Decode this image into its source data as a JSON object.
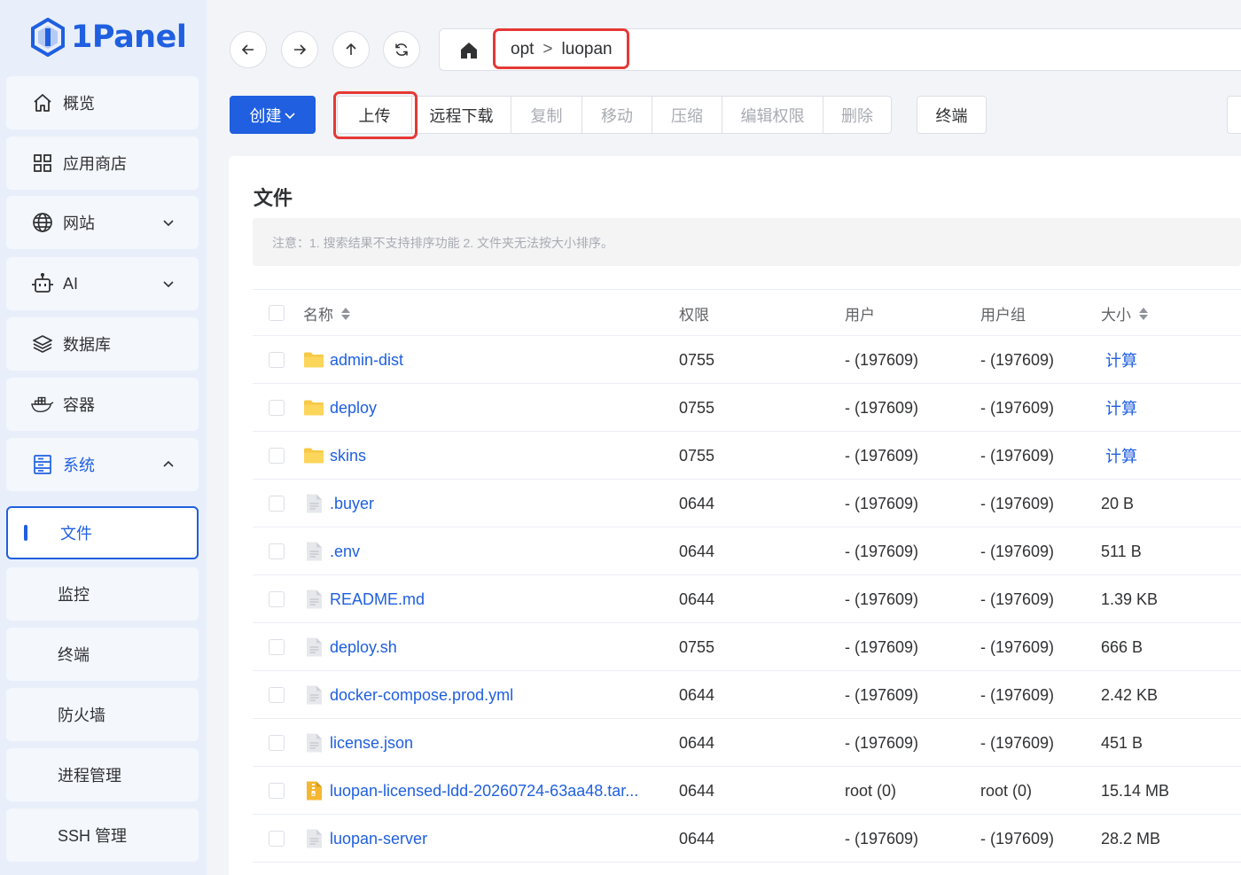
{
  "app": {
    "logo_text": "1Panel"
  },
  "sidebar": {
    "items": [
      {
        "label": "概览"
      },
      {
        "label": "应用商店"
      },
      {
        "label": "网站"
      },
      {
        "label": "AI"
      },
      {
        "label": "数据库"
      },
      {
        "label": "容器"
      },
      {
        "label": "系统"
      }
    ],
    "sub_items": [
      {
        "label": "文件"
      },
      {
        "label": "监控"
      },
      {
        "label": "终端"
      },
      {
        "label": "防火墙"
      },
      {
        "label": "进程管理"
      },
      {
        "label": "SSH 管理"
      }
    ]
  },
  "path": {
    "segments": [
      "opt",
      "luopan"
    ],
    "separator": ">"
  },
  "toolbar": {
    "create": "创建",
    "upload": "上传",
    "remote_download": "远程下载",
    "copy": "复制",
    "move": "移动",
    "compress": "压缩",
    "edit_permission": "编辑权限",
    "delete": "删除",
    "terminal": "终端"
  },
  "card": {
    "title": "文件",
    "notice": "注意：1. 搜索结果不支持排序功能 2. 文件夹无法按大小排序。"
  },
  "table": {
    "columns": {
      "name": "名称",
      "permission": "权限",
      "user": "用户",
      "group": "用户组",
      "size": "大小"
    },
    "rows": [
      {
        "name": "admin-dist",
        "type": "folder",
        "perm": "0755",
        "user": "- (197609)",
        "group": "- (197609)",
        "size": "计算"
      },
      {
        "name": "deploy",
        "type": "folder",
        "perm": "0755",
        "user": "- (197609)",
        "group": "- (197609)",
        "size": "计算"
      },
      {
        "name": "skins",
        "type": "folder",
        "perm": "0755",
        "user": "- (197609)",
        "group": "- (197609)",
        "size": "计算"
      },
      {
        "name": ".buyer",
        "type": "file",
        "perm": "0644",
        "user": "- (197609)",
        "group": "- (197609)",
        "size": "20 B"
      },
      {
        "name": ".env",
        "type": "file",
        "perm": "0644",
        "user": "- (197609)",
        "group": "- (197609)",
        "size": "511 B"
      },
      {
        "name": "README.md",
        "type": "file",
        "perm": "0644",
        "user": "- (197609)",
        "group": "- (197609)",
        "size": "1.39 KB"
      },
      {
        "name": "deploy.sh",
        "type": "file",
        "perm": "0755",
        "user": "- (197609)",
        "group": "- (197609)",
        "size": "666 B"
      },
      {
        "name": "docker-compose.prod.yml",
        "type": "file",
        "perm": "0644",
        "user": "- (197609)",
        "group": "- (197609)",
        "size": "2.42 KB"
      },
      {
        "name": "license.json",
        "type": "file",
        "perm": "0644",
        "user": "- (197609)",
        "group": "- (197609)",
        "size": "451 B"
      },
      {
        "name": "luopan-licensed-ldd-20260724-63aa48.tar...",
        "type": "archive",
        "perm": "0644",
        "user": "root (0)",
        "group": "root (0)",
        "size": "15.14 MB"
      },
      {
        "name": "luopan-server",
        "type": "file",
        "perm": "0644",
        "user": "- (197609)",
        "group": "- (197609)",
        "size": "28.2 MB"
      }
    ]
  },
  "colors": {
    "accent": "#1f5fe0",
    "highlight": "#e53935",
    "folder": "#f7c948",
    "archive": "#f5b731"
  }
}
